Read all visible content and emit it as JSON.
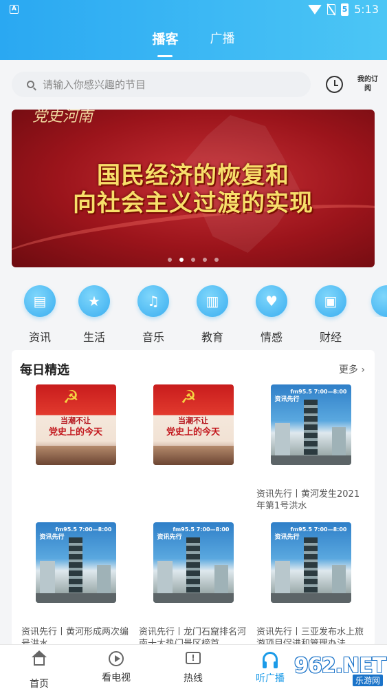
{
  "status_bar": {
    "time": "5:13",
    "battery_glyph": "5"
  },
  "top_tabs": [
    {
      "label": "播客",
      "active": true
    },
    {
      "label": "广播",
      "active": false
    }
  ],
  "search": {
    "placeholder": "请输入你感兴趣的节目"
  },
  "subscribe_label": "我的订阅",
  "banner": {
    "logo_text": "党史河南",
    "headline_line1": "国民经济的恢复和",
    "headline_line2": "向社会主义过渡的实现",
    "active_dot_index": 1,
    "dot_count": 5
  },
  "categories": [
    {
      "label": "资讯",
      "icon": "news-icon",
      "glyph": "▤"
    },
    {
      "label": "生活",
      "icon": "life-icon",
      "glyph": "★"
    },
    {
      "label": "音乐",
      "icon": "music-icon",
      "glyph": "♫"
    },
    {
      "label": "教育",
      "icon": "book-icon",
      "glyph": "▥"
    },
    {
      "label": "情感",
      "icon": "heart-icon",
      "glyph": "♥"
    },
    {
      "label": "财经",
      "icon": "wallet-icon",
      "glyph": "▣"
    }
  ],
  "daily": {
    "title": "每日精选",
    "more_label": "更多",
    "items": [
      {
        "caption": "",
        "thumb": "party",
        "thumb_line1": "当潮不让",
        "thumb_line2": "党史上的今天"
      },
      {
        "caption": "",
        "thumb": "party",
        "thumb_line1": "当潮不让",
        "thumb_line2": "党史上的今天"
      },
      {
        "caption": "资讯先行丨黄河发生2021年第1号洪水",
        "thumb": "tower",
        "thumb_name": "资讯先行",
        "thumb_freq": "fm95.5 7:00—8:00"
      },
      {
        "caption": "资讯先行丨黄河形成两次编号洪水",
        "thumb": "tower",
        "thumb_name": "资讯先行",
        "thumb_freq": "fm95.5 7:00—8:00"
      },
      {
        "caption": "资讯先行丨龙门石窟排名河南十大热门景区榜首",
        "thumb": "tower",
        "thumb_name": "资讯先行",
        "thumb_freq": "fm95.5 7:00—8:00"
      },
      {
        "caption": "资讯先行丨三亚发布水上旅游项目促进和管理办法",
        "thumb": "tower",
        "thumb_name": "资讯先行",
        "thumb_freq": "fm95.5 7:00—8:00"
      }
    ]
  },
  "bottom_nav": [
    {
      "label": "首页",
      "icon": "home-icon",
      "active": false
    },
    {
      "label": "看电视",
      "icon": "tv-play-icon",
      "active": false
    },
    {
      "label": "热线",
      "icon": "hotline-icon",
      "active": false
    },
    {
      "label": "听广播",
      "icon": "headphones-icon",
      "active": true
    }
  ],
  "watermark": {
    "big": "962.NET",
    "small": "乐游网"
  },
  "colors": {
    "accent": "#1c9be8",
    "header_start": "#2aa8f2",
    "header_end": "#4cc6f5",
    "banner_red": "#9b141b"
  }
}
